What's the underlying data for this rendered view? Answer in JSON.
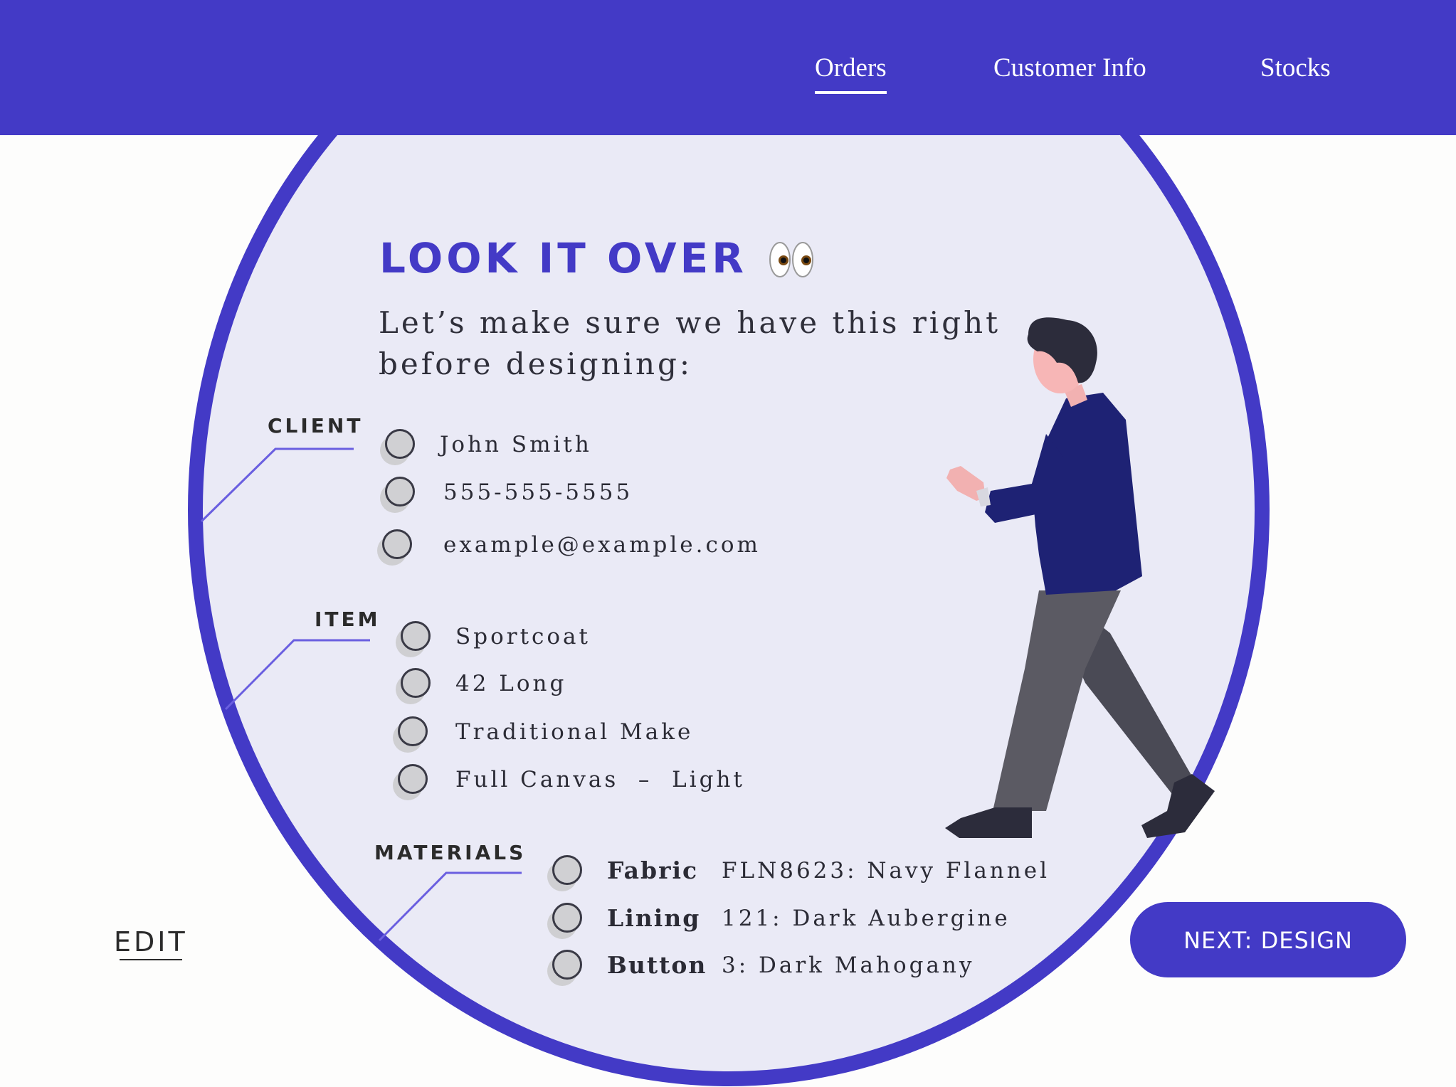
{
  "nav": {
    "items": [
      {
        "label": "Orders",
        "active": true
      },
      {
        "label": "Customer Info",
        "active": false
      },
      {
        "label": "Stocks",
        "active": false
      }
    ]
  },
  "header": {
    "title": "LOOK IT OVER",
    "title_icon": "eyes-emoji",
    "subtitle_line1": "Let’s make sure we have this right",
    "subtitle_line2": "before designing:"
  },
  "client": {
    "label": "CLIENT",
    "items": [
      "John Smith",
      "555-555-5555",
      "example@example.com"
    ]
  },
  "item": {
    "label": "ITEM",
    "items": [
      "Sportcoat",
      "42 Long",
      "Traditional Make",
      "Full Canvas  –  Light"
    ]
  },
  "materials": {
    "label": "MATERIALS",
    "items": [
      {
        "key": "Fabric",
        "value": "FLN8623: Navy Flannel"
      },
      {
        "key": "Lining",
        "value": "121: Dark Aubergine"
      },
      {
        "key": "Button",
        "value": "3: Dark Mahogany"
      }
    ]
  },
  "actions": {
    "edit_label": "EDIT",
    "next_label": "NEXT: DESIGN"
  },
  "colors": {
    "accent": "#433ac6",
    "circle_fill": "#eaeaf6",
    "connector": "#6a5fe0"
  }
}
